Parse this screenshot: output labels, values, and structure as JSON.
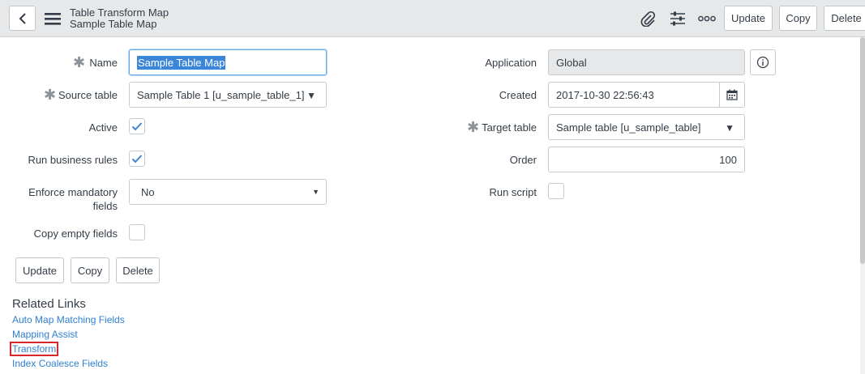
{
  "header": {
    "title": "Table Transform Map",
    "subtitle": "Sample Table Map",
    "buttons": {
      "update": "Update",
      "copy": "Copy",
      "delete": "Delete"
    }
  },
  "form": {
    "name": {
      "label": "Name",
      "value": "Sample Table Map",
      "required": true
    },
    "source_table": {
      "label": "Source table",
      "value": "Sample Table 1 [u_sample_table_1]",
      "required": true
    },
    "active": {
      "label": "Active",
      "checked": true
    },
    "run_business_rules": {
      "label": "Run business rules",
      "checked": true
    },
    "enforce_mandatory": {
      "label_line1": "Enforce mandatory",
      "label_line2": "fields",
      "value": "No"
    },
    "copy_empty_fields": {
      "label": "Copy empty fields",
      "checked": false
    },
    "application": {
      "label": "Application",
      "value": "Global"
    },
    "created": {
      "label": "Created",
      "value": "2017-10-30 22:56:43"
    },
    "target_table": {
      "label": "Target table",
      "value": "Sample table [u_sample_table]",
      "required": true
    },
    "order": {
      "label": "Order",
      "value": "100"
    },
    "run_script": {
      "label": "Run script",
      "checked": false
    }
  },
  "form_buttons": {
    "update": "Update",
    "copy": "Copy",
    "delete": "Delete"
  },
  "related_links": {
    "title": "Related Links",
    "links": [
      "Auto Map Matching Fields",
      "Mapping Assist",
      "Transform",
      "Index Coalesce Fields"
    ]
  },
  "colors": {
    "link": "#2f7fd1",
    "header_bg": "#e6e8ea",
    "selection": "#3b86d8",
    "highlight_box": "#d9262b",
    "check": "#3b86d8"
  }
}
